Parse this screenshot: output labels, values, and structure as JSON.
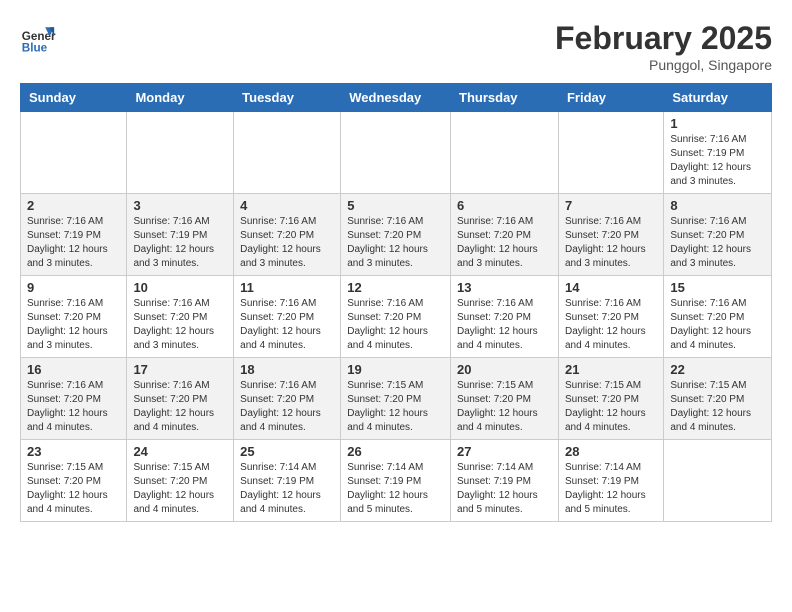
{
  "header": {
    "logo_general": "General",
    "logo_blue": "Blue",
    "month_title": "February 2025",
    "location": "Punggol, Singapore"
  },
  "days_of_week": [
    "Sunday",
    "Monday",
    "Tuesday",
    "Wednesday",
    "Thursday",
    "Friday",
    "Saturday"
  ],
  "weeks": [
    [
      {
        "day": "",
        "info": ""
      },
      {
        "day": "",
        "info": ""
      },
      {
        "day": "",
        "info": ""
      },
      {
        "day": "",
        "info": ""
      },
      {
        "day": "",
        "info": ""
      },
      {
        "day": "",
        "info": ""
      },
      {
        "day": "1",
        "info": "Sunrise: 7:16 AM\nSunset: 7:19 PM\nDaylight: 12 hours\nand 3 minutes."
      }
    ],
    [
      {
        "day": "2",
        "info": "Sunrise: 7:16 AM\nSunset: 7:19 PM\nDaylight: 12 hours\nand 3 minutes."
      },
      {
        "day": "3",
        "info": "Sunrise: 7:16 AM\nSunset: 7:19 PM\nDaylight: 12 hours\nand 3 minutes."
      },
      {
        "day": "4",
        "info": "Sunrise: 7:16 AM\nSunset: 7:20 PM\nDaylight: 12 hours\nand 3 minutes."
      },
      {
        "day": "5",
        "info": "Sunrise: 7:16 AM\nSunset: 7:20 PM\nDaylight: 12 hours\nand 3 minutes."
      },
      {
        "day": "6",
        "info": "Sunrise: 7:16 AM\nSunset: 7:20 PM\nDaylight: 12 hours\nand 3 minutes."
      },
      {
        "day": "7",
        "info": "Sunrise: 7:16 AM\nSunset: 7:20 PM\nDaylight: 12 hours\nand 3 minutes."
      },
      {
        "day": "8",
        "info": "Sunrise: 7:16 AM\nSunset: 7:20 PM\nDaylight: 12 hours\nand 3 minutes."
      }
    ],
    [
      {
        "day": "9",
        "info": "Sunrise: 7:16 AM\nSunset: 7:20 PM\nDaylight: 12 hours\nand 3 minutes."
      },
      {
        "day": "10",
        "info": "Sunrise: 7:16 AM\nSunset: 7:20 PM\nDaylight: 12 hours\nand 3 minutes."
      },
      {
        "day": "11",
        "info": "Sunrise: 7:16 AM\nSunset: 7:20 PM\nDaylight: 12 hours\nand 4 minutes."
      },
      {
        "day": "12",
        "info": "Sunrise: 7:16 AM\nSunset: 7:20 PM\nDaylight: 12 hours\nand 4 minutes."
      },
      {
        "day": "13",
        "info": "Sunrise: 7:16 AM\nSunset: 7:20 PM\nDaylight: 12 hours\nand 4 minutes."
      },
      {
        "day": "14",
        "info": "Sunrise: 7:16 AM\nSunset: 7:20 PM\nDaylight: 12 hours\nand 4 minutes."
      },
      {
        "day": "15",
        "info": "Sunrise: 7:16 AM\nSunset: 7:20 PM\nDaylight: 12 hours\nand 4 minutes."
      }
    ],
    [
      {
        "day": "16",
        "info": "Sunrise: 7:16 AM\nSunset: 7:20 PM\nDaylight: 12 hours\nand 4 minutes."
      },
      {
        "day": "17",
        "info": "Sunrise: 7:16 AM\nSunset: 7:20 PM\nDaylight: 12 hours\nand 4 minutes."
      },
      {
        "day": "18",
        "info": "Sunrise: 7:16 AM\nSunset: 7:20 PM\nDaylight: 12 hours\nand 4 minutes."
      },
      {
        "day": "19",
        "info": "Sunrise: 7:15 AM\nSunset: 7:20 PM\nDaylight: 12 hours\nand 4 minutes."
      },
      {
        "day": "20",
        "info": "Sunrise: 7:15 AM\nSunset: 7:20 PM\nDaylight: 12 hours\nand 4 minutes."
      },
      {
        "day": "21",
        "info": "Sunrise: 7:15 AM\nSunset: 7:20 PM\nDaylight: 12 hours\nand 4 minutes."
      },
      {
        "day": "22",
        "info": "Sunrise: 7:15 AM\nSunset: 7:20 PM\nDaylight: 12 hours\nand 4 minutes."
      }
    ],
    [
      {
        "day": "23",
        "info": "Sunrise: 7:15 AM\nSunset: 7:20 PM\nDaylight: 12 hours\nand 4 minutes."
      },
      {
        "day": "24",
        "info": "Sunrise: 7:15 AM\nSunset: 7:20 PM\nDaylight: 12 hours\nand 4 minutes."
      },
      {
        "day": "25",
        "info": "Sunrise: 7:14 AM\nSunset: 7:19 PM\nDaylight: 12 hours\nand 4 minutes."
      },
      {
        "day": "26",
        "info": "Sunrise: 7:14 AM\nSunset: 7:19 PM\nDaylight: 12 hours\nand 5 minutes."
      },
      {
        "day": "27",
        "info": "Sunrise: 7:14 AM\nSunset: 7:19 PM\nDaylight: 12 hours\nand 5 minutes."
      },
      {
        "day": "28",
        "info": "Sunrise: 7:14 AM\nSunset: 7:19 PM\nDaylight: 12 hours\nand 5 minutes."
      },
      {
        "day": "",
        "info": ""
      }
    ]
  ]
}
